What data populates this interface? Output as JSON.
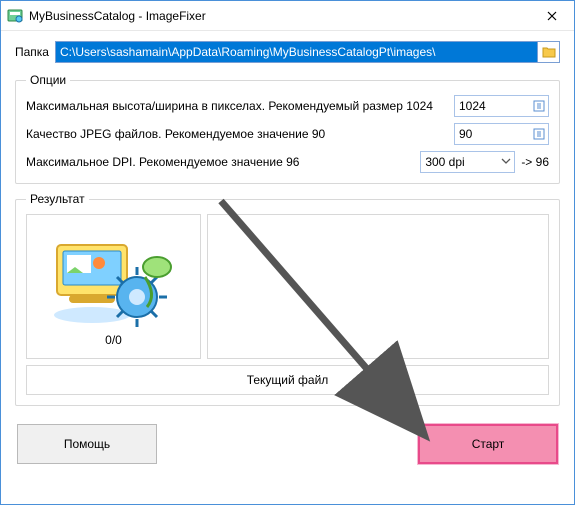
{
  "window": {
    "title": "MyBusinessCatalog - ImageFixer"
  },
  "path": {
    "label": "Папка",
    "value": "C:\\Users\\sashamain\\AppData\\Roaming\\MyBusinessCatalogPt\\images\\"
  },
  "options": {
    "legend": "Опции",
    "maxSize": {
      "label": "Максимальная  высота/ширина в пикселах. Рекомендуемый размер 1024",
      "value": "1024"
    },
    "jpegQuality": {
      "label": "Качество JPEG файлов. Рекомендуемое значение 90",
      "value": "90"
    },
    "maxDpi": {
      "label": "Максимальное DPI. Рекомендуемое значение 96",
      "value": "300 dpi",
      "suffix": "-> 96"
    }
  },
  "result": {
    "legend": "Результат",
    "count": "0/0",
    "currentFile": "Текущий файл"
  },
  "buttons": {
    "help": "Помощь",
    "start": "Старт"
  }
}
